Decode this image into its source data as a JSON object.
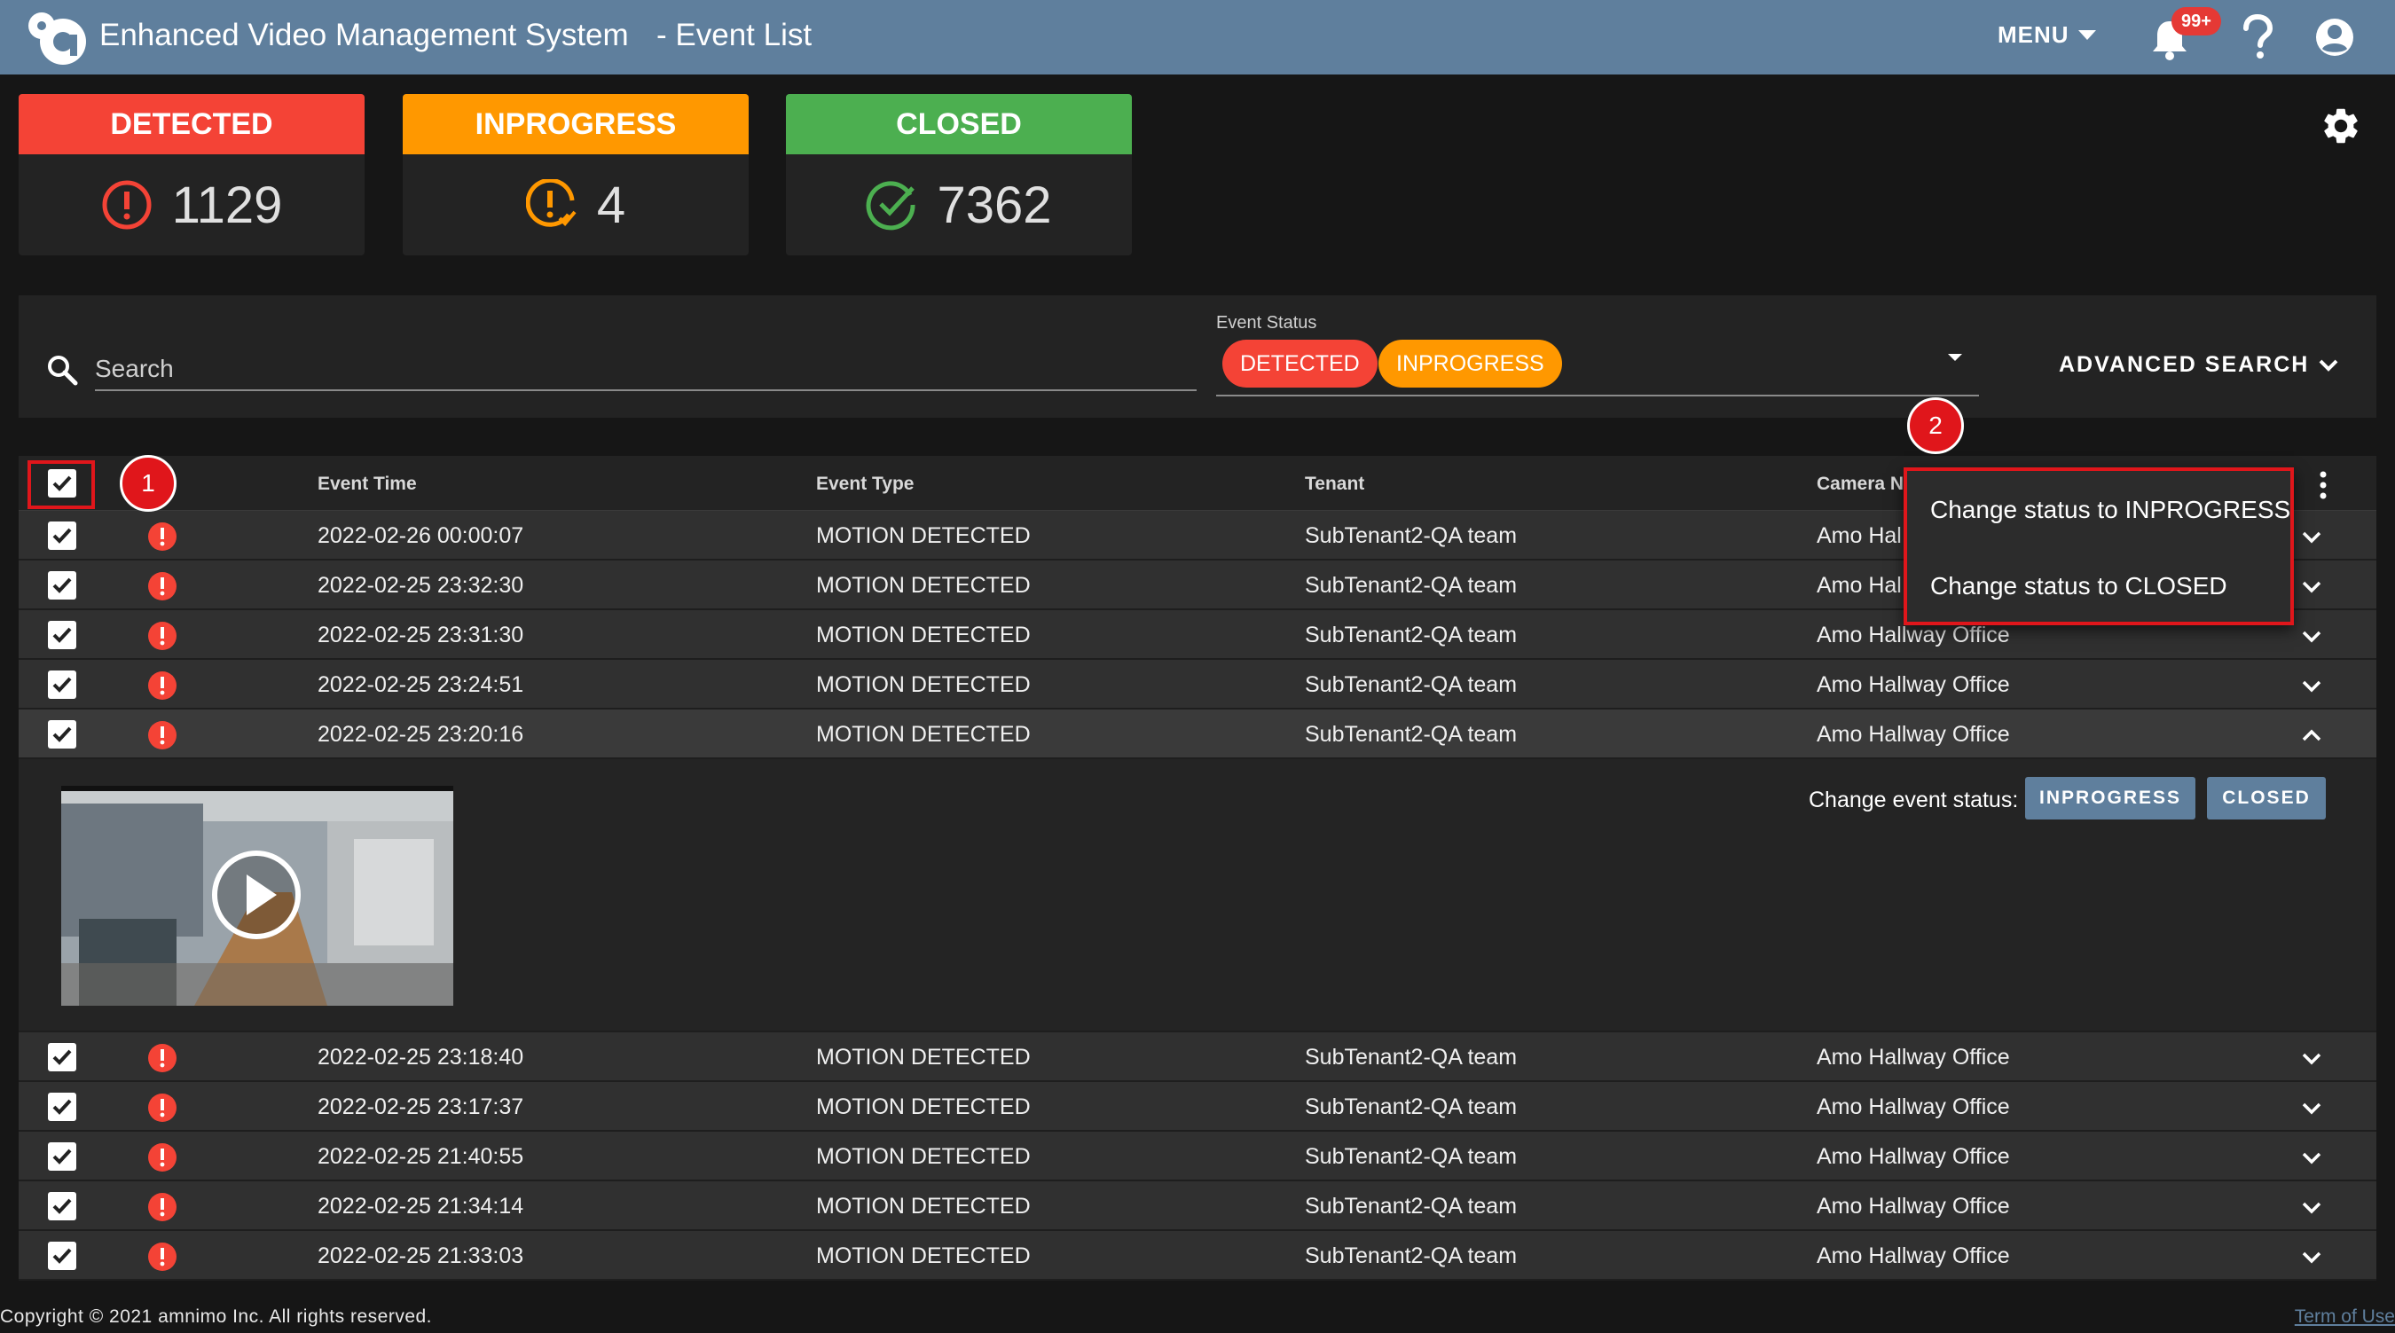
{
  "header": {
    "app_title": "Enhanced Video Management System",
    "page_subtitle": "- Event List",
    "menu_label": "MENU",
    "notification_badge": "99+",
    "brand_color": "#5f7f9d"
  },
  "stat_cards": [
    {
      "label": "DETECTED",
      "count": "1129",
      "color": "#f44336",
      "icon": "alert-circle-icon"
    },
    {
      "label": "INPROGRESS",
      "count": "4",
      "color": "#ff9800",
      "icon": "alert-progress-icon"
    },
    {
      "label": "CLOSED",
      "count": "7362",
      "color": "#4caf50",
      "icon": "check-circle-icon"
    }
  ],
  "search": {
    "placeholder": "Search",
    "status_label": "Event Status",
    "status_chips": [
      "DETECTED",
      "INPROGRESS"
    ],
    "advanced_label": "ADVANCED SEARCH"
  },
  "table": {
    "columns": [
      "Event Time",
      "Event Type",
      "Tenant",
      "Camera Na"
    ],
    "rows": [
      {
        "time": "2022-02-26 00:00:07",
        "type": "MOTION DETECTED",
        "tenant": "SubTenant2-QA team",
        "camera": "Amo Hal"
      },
      {
        "time": "2022-02-25 23:32:30",
        "type": "MOTION DETECTED",
        "tenant": "SubTenant2-QA team",
        "camera": "Amo Hal"
      },
      {
        "time": "2022-02-25 23:31:30",
        "type": "MOTION DETECTED",
        "tenant": "SubTenant2-QA team",
        "camera": "Amo Hallway Office"
      },
      {
        "time": "2022-02-25 23:24:51",
        "type": "MOTION DETECTED",
        "tenant": "SubTenant2-QA team",
        "camera": "Amo Hallway Office"
      },
      {
        "time": "2022-02-25 23:20:16",
        "type": "MOTION DETECTED",
        "tenant": "SubTenant2-QA team",
        "camera": "Amo Hallway Office"
      },
      {
        "time": "2022-02-25 23:18:40",
        "type": "MOTION DETECTED",
        "tenant": "SubTenant2-QA team",
        "camera": "Amo Hallway Office"
      },
      {
        "time": "2022-02-25 23:17:37",
        "type": "MOTION DETECTED",
        "tenant": "SubTenant2-QA team",
        "camera": "Amo Hallway Office"
      },
      {
        "time": "2022-02-25 21:40:55",
        "type": "MOTION DETECTED",
        "tenant": "SubTenant2-QA team",
        "camera": "Amo Hallway Office"
      },
      {
        "time": "2022-02-25 21:34:14",
        "type": "MOTION DETECTED",
        "tenant": "SubTenant2-QA team",
        "camera": "Amo Hallway Office"
      },
      {
        "time": "2022-02-25 21:33:03",
        "type": "MOTION DETECTED",
        "tenant": "SubTenant2-QA team",
        "camera": "Amo Hallway Office"
      }
    ],
    "expanded": {
      "change_status_label": "Change event status:",
      "buttons": [
        "INPROGRESS",
        "CLOSED"
      ]
    }
  },
  "bulk_menu": {
    "items": [
      "Change status to INPROGRESS",
      "Change status to CLOSED"
    ]
  },
  "markers": [
    "1",
    "2"
  ],
  "footer": {
    "copyright": "Copyright © 2021 amnimo Inc. All rights reserved.",
    "terms": "Term of Use"
  }
}
